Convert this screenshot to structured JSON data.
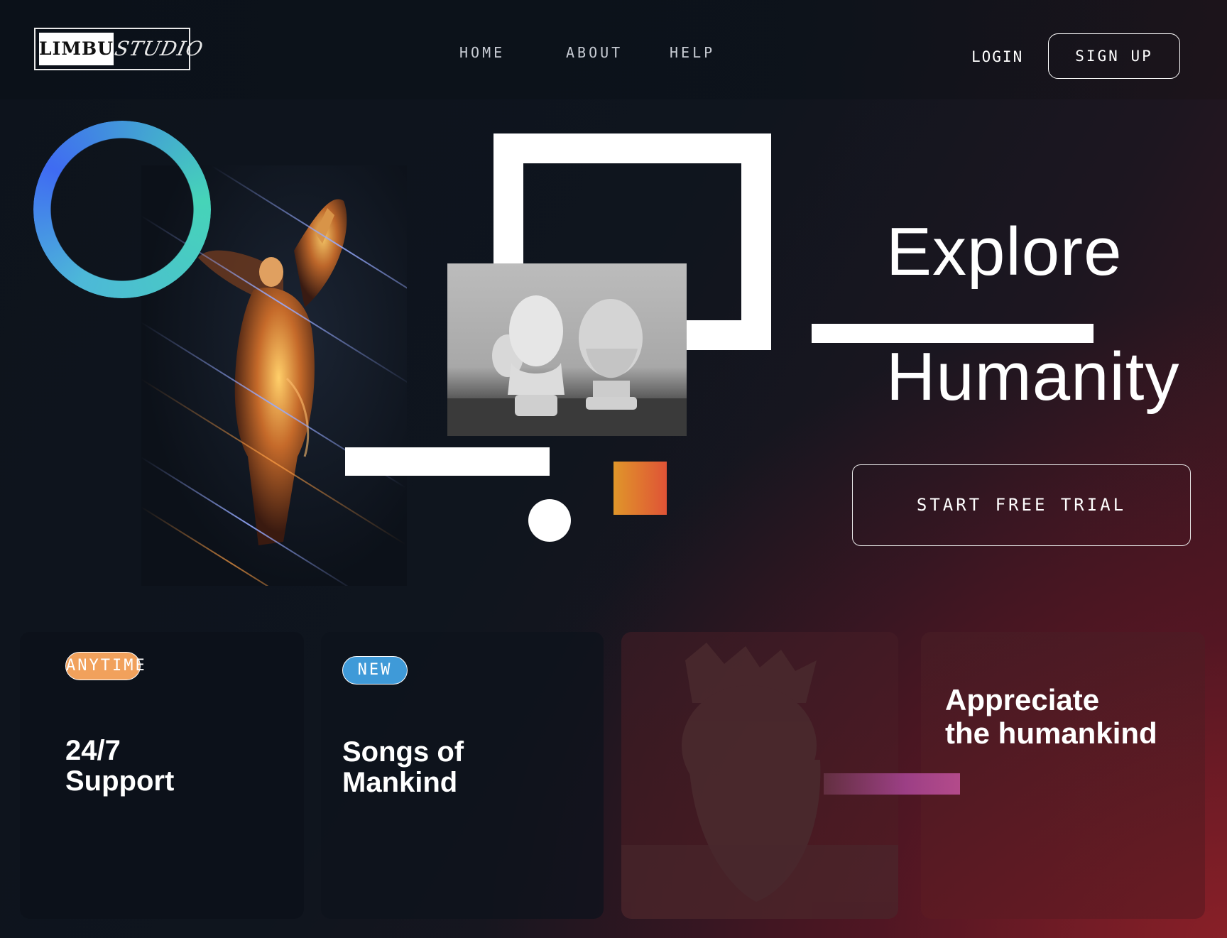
{
  "header": {
    "logo": {
      "word": "LIMBU",
      "script": "STUDIO"
    },
    "nav": [
      {
        "label": "HOME"
      },
      {
        "label": "ABOUT"
      },
      {
        "label": "HELP"
      }
    ],
    "login_label": "LOGIN",
    "signup_label": "SIGN UP"
  },
  "hero": {
    "title_line1": "Explore",
    "title_line2": "Humanity",
    "cta_label": "START FREE TRIAL"
  },
  "cards": [
    {
      "badge": "ANYTIME",
      "badge_color": "#f1a15c",
      "title": "24/7\nSupport"
    },
    {
      "badge": "NEW",
      "badge_color": "#3f9ad8",
      "title": "Songs of\nMankind"
    },
    {
      "image": "crowned-statue-image"
    },
    {
      "title": "Appreciate\nthe humankind"
    }
  ],
  "colors": {
    "ring_gradient": [
      "#3f6bf2",
      "#46d4b8"
    ],
    "orange_square": [
      "#e0962a",
      "#df5336"
    ],
    "background_accent": "#8c2028"
  }
}
